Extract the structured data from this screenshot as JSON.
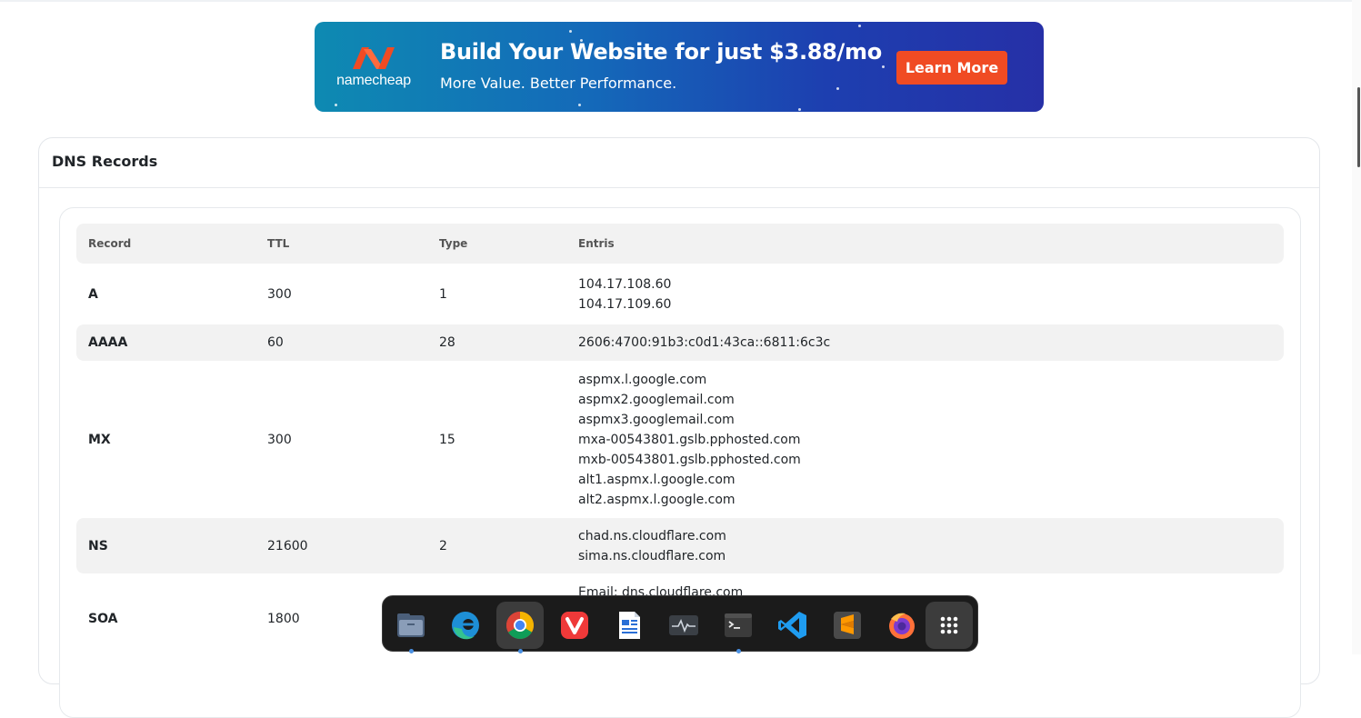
{
  "banner": {
    "brand": "namecheap",
    "headline": "Build Your Website for just $3.88/mo",
    "subline": "More Value. Better Performance.",
    "cta": "Learn More",
    "colors": {
      "gradient_start": "#0e8ab2",
      "gradient_end": "#2630a7",
      "cta": "#f04b23",
      "logo": "#f04b23"
    }
  },
  "card": {
    "title": "DNS Records"
  },
  "table": {
    "headers": [
      "Record",
      "TTL",
      "Type",
      "Entris"
    ],
    "rows": [
      {
        "record": "A",
        "ttl": "300",
        "type": "1",
        "entries": [
          "104.17.108.60",
          "104.17.109.60"
        ]
      },
      {
        "record": "AAAA",
        "ttl": "60",
        "type": "28",
        "entries": [
          "2606:4700:91b3:c0d1:43ca::6811:6c3c"
        ]
      },
      {
        "record": "MX",
        "ttl": "300",
        "type": "15",
        "entries": [
          "aspmx.l.google.com",
          "aspmx2.googlemail.com",
          "aspmx3.googlemail.com",
          "mxa-00543801.gslb.pphosted.com",
          "mxb-00543801.gslb.pphosted.com",
          "alt1.aspmx.l.google.com",
          "alt2.aspmx.l.google.com"
        ]
      },
      {
        "record": "NS",
        "ttl": "21600",
        "type": "2",
        "entries": [
          "chad.ns.cloudflare.com",
          "sima.ns.cloudflare.com"
        ]
      },
      {
        "record": "SOA",
        "ttl": "1800",
        "type": "",
        "entries": [
          "Email: dns.cloudflare.com"
        ]
      }
    ]
  },
  "dock": {
    "apps": [
      {
        "name": "files-icon",
        "active": false,
        "running": true
      },
      {
        "name": "edge-icon",
        "active": false,
        "running": false
      },
      {
        "name": "chrome-icon",
        "active": true,
        "running": true
      },
      {
        "name": "vivaldi-icon",
        "active": false,
        "running": false
      },
      {
        "name": "text-editor-icon",
        "active": false,
        "running": false
      },
      {
        "name": "system-monitor-icon",
        "active": false,
        "running": false
      },
      {
        "name": "terminal-icon",
        "active": false,
        "running": true
      },
      {
        "name": "vscode-icon",
        "active": false,
        "running": false
      },
      {
        "name": "sublime-text-icon",
        "active": false,
        "running": false
      },
      {
        "name": "firefox-icon",
        "active": false,
        "running": false
      },
      {
        "name": "app-grid-icon",
        "active": true,
        "running": false
      }
    ]
  }
}
